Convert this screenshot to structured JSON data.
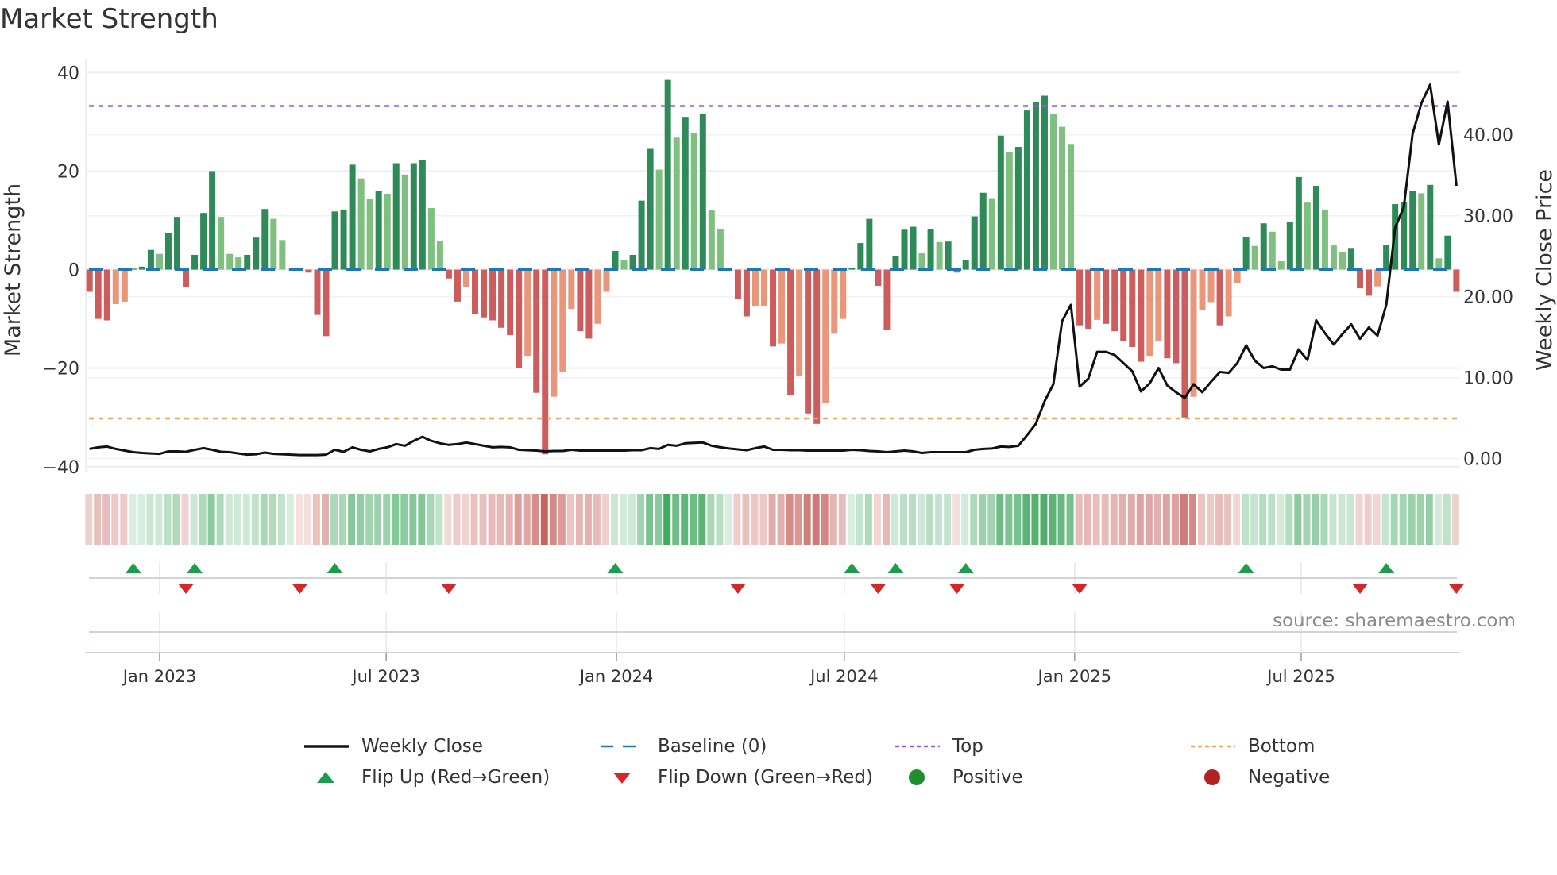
{
  "title": "Market Strength",
  "source": "source: sharemaestro.com",
  "colors": {
    "pos_up": "#2e8b57",
    "pos_down": "#7fbf7f",
    "neg_down": "#cd5c5c",
    "neg_up": "#e9967a",
    "baseline": "#1f77b4",
    "top": "#9b59d6",
    "bottom": "#f0a35e",
    "price": "#111111",
    "flip_up": "#1a9e4a",
    "flip_down": "#d62728",
    "positive": "#1e8f2e",
    "negative": "#b22222",
    "heat_pos": "#2ea050",
    "heat_neg": "#c0504b"
  },
  "legend": [
    {
      "label": "Weekly Close",
      "icon": "line-solid-icon",
      "color": "#111111"
    },
    {
      "label": "Baseline (0)",
      "icon": "line-dashed-icon",
      "color": "#1f77b4"
    },
    {
      "label": "Top",
      "icon": "line-dotted-icon",
      "color": "#9b59d6"
    },
    {
      "label": "Bottom",
      "icon": "line-dotted-icon",
      "color": "#f0a35e"
    },
    {
      "label": "Flip Up (Red→Green)",
      "icon": "triangle-up-icon",
      "color": "#1a9e4a"
    },
    {
      "label": "Flip Down (Green→Red)",
      "icon": "triangle-down-icon",
      "color": "#d62728"
    },
    {
      "label": "Positive",
      "icon": "circle-icon",
      "color": "#1e8f2e"
    },
    {
      "label": "Negative",
      "icon": "circle-icon",
      "color": "#b22222"
    }
  ],
  "chart_data": {
    "type": "bar",
    "title": "Market Strength",
    "ylabel": "Market Strength",
    "y2label": "Weekly Close Price",
    "x_start": "2022-11-06",
    "x_step_days": 7,
    "ylim": [
      -41,
      41.5
    ],
    "y2lim": [
      -1.6,
      48.6
    ],
    "yticks": [
      {
        "v": 40,
        "label": "40"
      },
      {
        "v": 20,
        "label": "20"
      },
      {
        "v": 0,
        "label": "0"
      },
      {
        "v": -20,
        "label": "−20"
      },
      {
        "v": -40,
        "label": "−40"
      }
    ],
    "y2ticks": [
      {
        "v": 40,
        "label": "40.00"
      },
      {
        "v": 30,
        "label": "30.00"
      },
      {
        "v": 20,
        "label": "20.00"
      },
      {
        "v": 10,
        "label": "10.00"
      },
      {
        "v": 0,
        "label": "0.00"
      }
    ],
    "xticks": [
      {
        "date": "2023-01-01",
        "label": "Jan 2023"
      },
      {
        "date": "2023-07-01",
        "label": "Jul 2023"
      },
      {
        "date": "2024-01-01",
        "label": "Jan 2024"
      },
      {
        "date": "2024-07-01",
        "label": "Jul 2024"
      },
      {
        "date": "2025-01-01",
        "label": "Jan 2025"
      },
      {
        "date": "2025-07-01",
        "label": "Jul 2025"
      }
    ],
    "top_level": 33.2,
    "bottom_level": -30.2,
    "baseline": 0,
    "strength": [
      -4.5,
      -10,
      -10.3,
      -7,
      -6.5,
      0.2,
      0.6,
      4,
      3.2,
      7.5,
      10.7,
      -3.5,
      3,
      11.5,
      20,
      10.7,
      3.2,
      2.5,
      3,
      6.5,
      12.3,
      10.3,
      6,
      0.1,
      -0.2,
      -0.6,
      -9.2,
      -13.5,
      11.8,
      12.2,
      21.3,
      18.5,
      14.3,
      16,
      15.4,
      21.6,
      19.3,
      21.6,
      22.3,
      12.5,
      5.8,
      -1.8,
      -6.5,
      -3.5,
      -9,
      -9.7,
      -10.3,
      -11.8,
      -13.3,
      -20,
      -17.5,
      -25,
      -37.5,
      -25.8,
      -20.8,
      -8,
      -12.5,
      -14,
      -11,
      -4.5,
      3.8,
      2,
      3,
      14,
      24.5,
      20.3,
      38.5,
      26.8,
      31,
      27.7,
      31.6,
      12,
      8.3,
      0.1,
      -6,
      -9.5,
      -7.5,
      -7.4,
      -15.6,
      -15,
      -25.5,
      -21.5,
      -29.2,
      -31.3,
      -27,
      -13,
      -10,
      0.4,
      5.4,
      10.3,
      -3.3,
      -12.3,
      2.7,
      8.1,
      8.7,
      3.3,
      8.3,
      5.6,
      5.7,
      -0.6,
      2,
      10.8,
      15.6,
      14.5,
      27.2,
      23.8,
      24.9,
      32.3,
      34,
      35.3,
      31.5,
      29,
      25.5,
      -11.3,
      -12,
      -10.2,
      -11,
      -12.5,
      -14.5,
      -15.7,
      -18.7,
      -17.5,
      -14.5,
      -18,
      -19,
      -30,
      -25.8,
      -8.2,
      -6.6,
      -11.3,
      -9.5,
      -2.8,
      6.7,
      4.8,
      9.4,
      7.7,
      1.7,
      9.6,
      18.8,
      13.6,
      17,
      12.2,
      4.9,
      3.5,
      4.4,
      -3.8,
      -5.3,
      -3.4,
      5,
      13.3,
      13.7,
      16,
      15.5,
      17.2,
      2.3,
      6.9,
      -4.5
    ],
    "weekly_close": [
      1.2,
      1.4,
      1.5,
      1.2,
      1.0,
      0.8,
      0.7,
      0.65,
      0.6,
      0.9,
      0.9,
      0.85,
      1.1,
      1.3,
      1.1,
      0.85,
      0.8,
      0.65,
      0.5,
      0.55,
      0.75,
      0.6,
      0.55,
      0.5,
      0.45,
      0.45,
      0.45,
      0.5,
      1.1,
      0.85,
      1.4,
      1.1,
      0.9,
      1.2,
      1.4,
      1.8,
      1.6,
      2.2,
      2.7,
      2.2,
      1.9,
      1.7,
      1.8,
      2.0,
      1.8,
      1.6,
      1.4,
      1.45,
      1.4,
      1.1,
      1.05,
      1.0,
      0.9,
      0.95,
      0.95,
      1.1,
      1.0,
      1.0,
      1.0,
      1.0,
      1.0,
      1.0,
      1.05,
      1.05,
      1.3,
      1.2,
      1.7,
      1.6,
      1.9,
      1.95,
      2.0,
      1.6,
      1.4,
      1.25,
      1.15,
      1.05,
      1.3,
      1.5,
      1.1,
      1.1,
      1.05,
      1.05,
      1.0,
      1.0,
      1.0,
      1.0,
      1.0,
      1.1,
      1.05,
      0.95,
      0.9,
      0.8,
      0.9,
      1.0,
      0.9,
      0.7,
      0.8,
      0.8,
      0.8,
      0.8,
      0.8,
      1.1,
      1.2,
      1.25,
      1.5,
      1.45,
      1.6,
      2.9,
      4.3,
      7.1,
      9.2,
      17,
      19,
      8.9,
      9.9,
      13.2,
      13.2,
      12.8,
      11.8,
      10.8,
      8.3,
      9.3,
      11.2,
      9.05,
      8.2,
      7.5,
      9.2,
      8.2,
      9.5,
      10.7,
      10.6,
      11.8,
      14.0,
      12.1,
      11.2,
      11.4,
      11.0,
      11.0,
      13.5,
      12.2,
      17.1,
      15.5,
      14.1,
      15.4,
      16.6,
      14.8,
      16.2,
      15.2,
      19.0,
      28.5,
      31.1,
      40.1,
      43.9,
      46.2,
      38.8,
      44.1,
      33.7
    ]
  }
}
